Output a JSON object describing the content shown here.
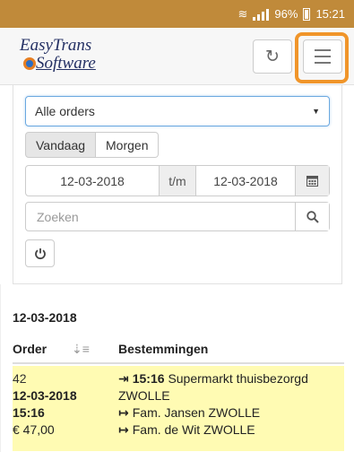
{
  "statusbar": {
    "battery_text": "96%",
    "time": "15:21"
  },
  "app": {
    "logo_line1": "EasyTrans",
    "logo_line2": "Software"
  },
  "filters": {
    "order_select": "Alle orders",
    "today_button": "Vandaag",
    "tomorrow_button": "Morgen",
    "date_from": "12-03-2018",
    "date_separator": "t/m",
    "date_to": "12-03-2018",
    "search_placeholder": "Zoeken"
  },
  "list": {
    "date_heading": "12-03-2018",
    "col_order": "Order",
    "col_destinations": "Bestemmingen",
    "rows": [
      {
        "order_no": "42",
        "date": "12-03-2018",
        "time": "15:16",
        "price": "€ 47,00",
        "pickup_time": "15:16",
        "pickup_name": "Supermarkt thuisbezorgd",
        "pickup_city": "ZWOLLE",
        "dest1": "Fam. Jansen ZWOLLE",
        "dest2": "Fam. de Wit ZWOLLE"
      }
    ]
  },
  "colors": {
    "statusbar": "#c08a3a",
    "highlight": "#f0952a",
    "row_bg": "#fffbb3"
  }
}
